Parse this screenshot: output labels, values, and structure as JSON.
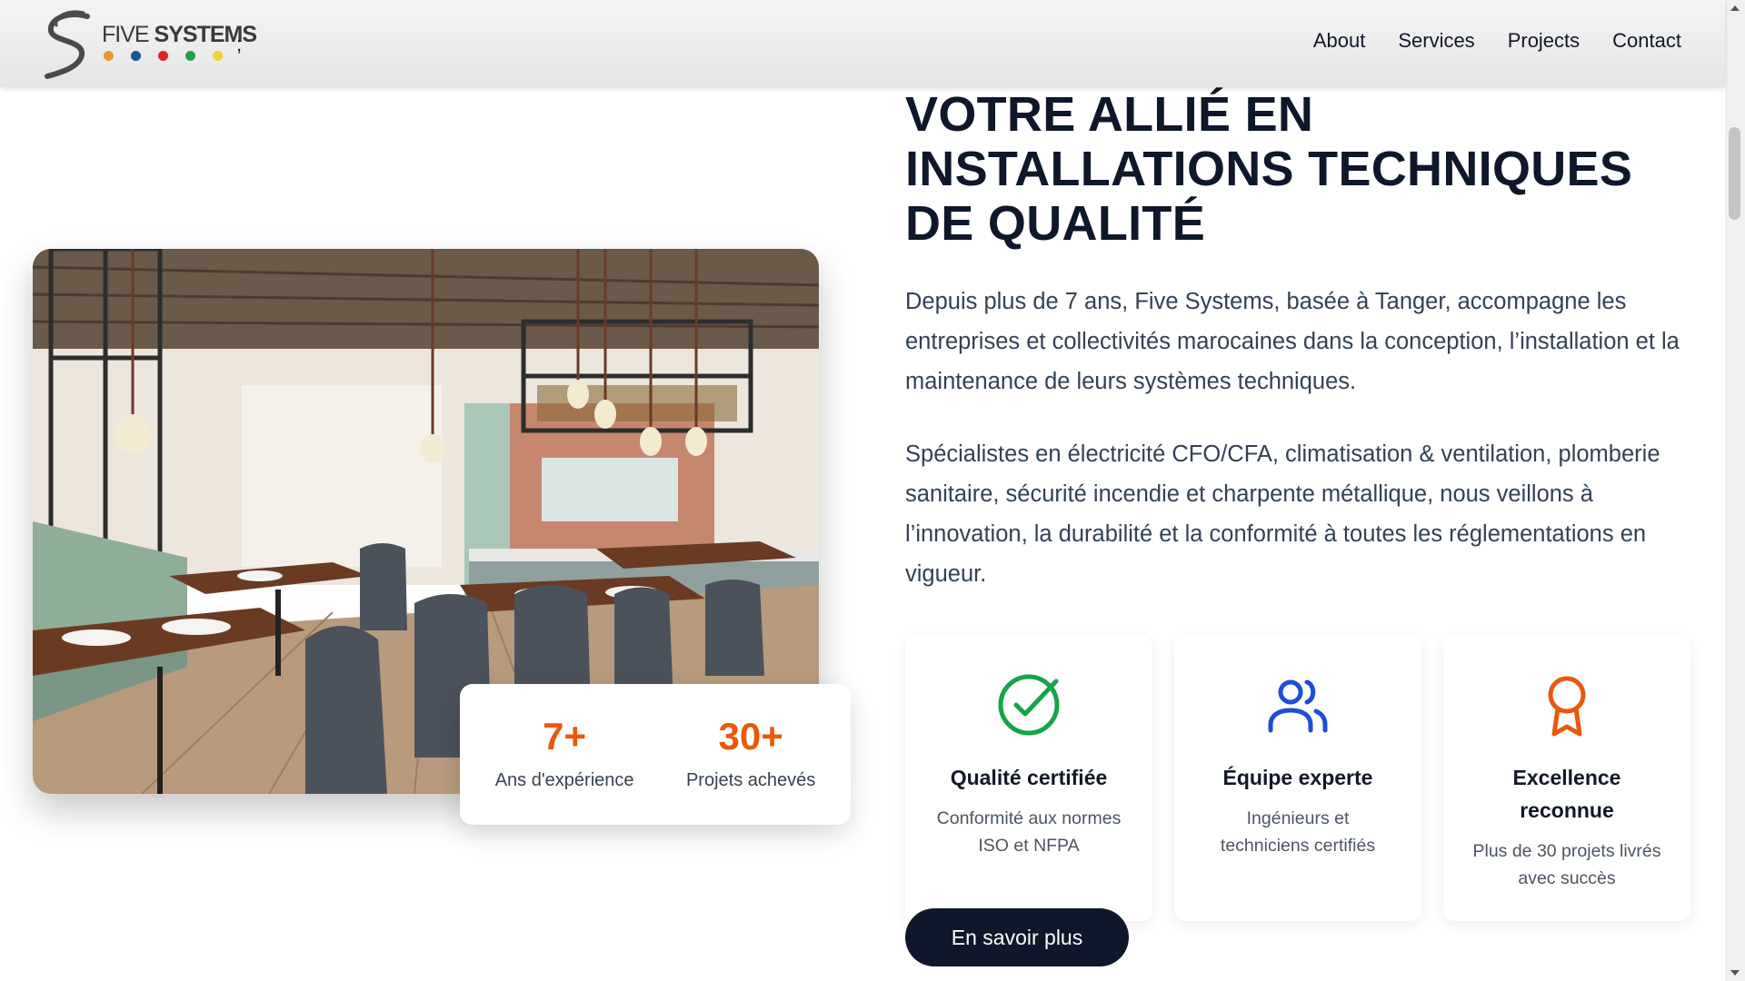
{
  "brand": {
    "name_light": "FIVE",
    "name_bold": "SYSTEMS",
    "trailing_char": ";",
    "dot_colors": [
      "#e8962e",
      "#0e5a8a",
      "#e02424",
      "#22a045",
      "#f2d22e"
    ]
  },
  "nav": {
    "items": [
      {
        "label": "About"
      },
      {
        "label": "Services"
      },
      {
        "label": "Projects"
      },
      {
        "label": "Contact"
      }
    ]
  },
  "hero": {
    "title": "VOTRE ALLIÉ EN INSTALLATIONS TECHNIQUES DE QUALITÉ",
    "paragraph1": "Depuis plus de 7 ans, Five Systems, basée à Tanger, accompagne les entreprises et collectivités marocaines dans la conception, l’installation et la maintenance de leurs systèmes techniques.",
    "paragraph2": "Spécialistes en électricité CFO/CFA, climatisation & ventilation, plomberie sanitaire, sécurité incendie et charpente métallique, nous veillons à l’innovation, la durabilité et la conformité à toutes les réglementations en vigueur.",
    "cta_label": "En savoir plus"
  },
  "stats": [
    {
      "value": "7+",
      "label": "Ans d'expérience"
    },
    {
      "value": "30+",
      "label": "Projets achevés"
    }
  ],
  "features": [
    {
      "icon": "check-circle-icon",
      "color": "#16a34a",
      "title": "Qualité certifiée",
      "desc": "Conformité aux normes ISO et NFPA"
    },
    {
      "icon": "users-icon",
      "color": "#1d4ed8",
      "title": "Équipe experte",
      "desc": "Ingénieurs et techniciens certifiés"
    },
    {
      "icon": "award-icon",
      "color": "#ea580c",
      "title": "Excellence reconnue",
      "desc": "Plus de 30 projets livrés avec succès"
    }
  ],
  "colors": {
    "accent_orange": "#ea580c",
    "navy": "#0f172a"
  }
}
